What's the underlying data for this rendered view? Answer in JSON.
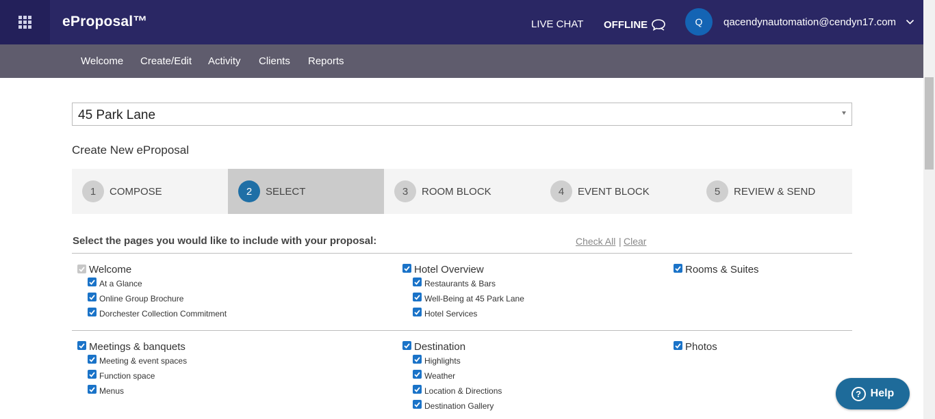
{
  "header": {
    "brand": "eProposal™",
    "live_chat": "LIVE CHAT",
    "offline": "OFFLINE",
    "avatar_initial": "Q",
    "user_email": "qacendynautomation@cendyn17.com"
  },
  "nav": [
    "Welcome",
    "Create/Edit",
    "Activity",
    "Clients",
    "Reports"
  ],
  "property": {
    "selected": "45 Park Lane"
  },
  "page_heading": "Create New eProposal",
  "steps": [
    {
      "num": "1",
      "label": "COMPOSE",
      "active": false
    },
    {
      "num": "2",
      "label": "SELECT",
      "active": true
    },
    {
      "num": "3",
      "label": "ROOM BLOCK",
      "active": false
    },
    {
      "num": "4",
      "label": "EVENT BLOCK",
      "active": false
    },
    {
      "num": "5",
      "label": "REVIEW & SEND",
      "active": false
    }
  ],
  "selection": {
    "title": "Select the pages you would like to include with your proposal:",
    "check_all": "Check All",
    "separator": "|",
    "clear": "Clear"
  },
  "groups": {
    "welcome": {
      "label": "Welcome",
      "checked": true,
      "disabled": true,
      "items": [
        "At a Glance",
        "Online Group Brochure",
        "Dorchester Collection Commitment"
      ]
    },
    "hotel_overview": {
      "label": "Hotel Overview",
      "checked": true,
      "items": [
        "Restaurants & Bars",
        "Well-Being at 45 Park Lane",
        "Hotel Services"
      ]
    },
    "rooms_suites": {
      "label": "Rooms & Suites",
      "checked": true,
      "items": []
    },
    "meetings": {
      "label": "Meetings & banquets",
      "checked": true,
      "items": [
        "Meeting & event spaces",
        "Function space",
        "Menus"
      ]
    },
    "destination": {
      "label": "Destination",
      "checked": true,
      "items": [
        "Highlights",
        "Weather",
        "Location & Directions",
        "Destination Gallery"
      ]
    },
    "photos": {
      "label": "Photos",
      "checked": true,
      "items": []
    }
  },
  "help": {
    "label": "Help",
    "icon": "question-icon"
  },
  "colors": {
    "header_bg": "#2a2764",
    "nav_bg": "#5f5c6d",
    "accent": "#1f6fa6",
    "checkbox": "#1a73c8"
  }
}
